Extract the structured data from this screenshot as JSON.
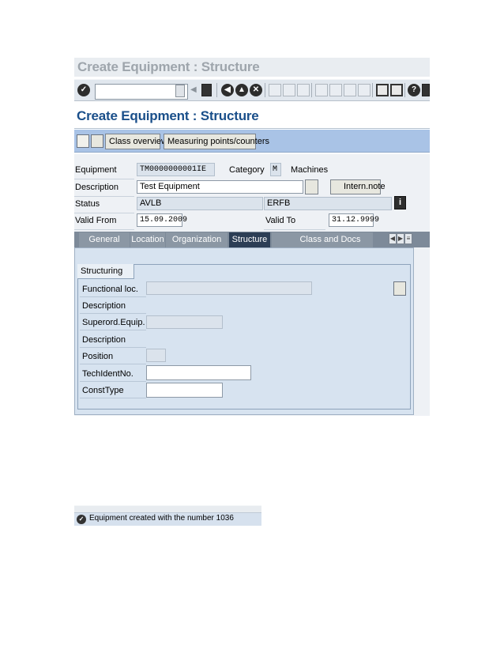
{
  "window": {
    "title": "Create Equipment : Structure"
  },
  "screen": {
    "title": "Create Equipment : Structure"
  },
  "toolbar": {
    "icons": [
      "enter-icon",
      "command-field",
      "back-icon",
      "save-icon",
      "back-nav-icon",
      "exit-icon",
      "cancel-icon",
      "print-icon",
      "find-icon",
      "find-next-icon",
      "first-page-icon",
      "previous-page-icon",
      "next-page-icon",
      "last-page-icon",
      "create-session-icon",
      "shortcut-icon",
      "help-icon",
      "layout-menu-icon"
    ]
  },
  "app_toolbar": {
    "class_overview": "Class overview",
    "measuring_points": "Measuring points/counters"
  },
  "header": {
    "equipment_label": "Equipment",
    "equipment_value": "TM0000000001IE",
    "category_label": "Category",
    "category_value": "M",
    "category_text": "Machines",
    "description_label": "Description",
    "description_value": "Test Equipment",
    "intern_note": "Intern.note",
    "status_label": "Status",
    "status_value": "AVLB",
    "status_value2": "ERFB",
    "valid_from_label": "Valid From",
    "valid_from_value": "15.09.2009",
    "valid_to_label": "Valid To",
    "valid_to_value": "31.12.9999"
  },
  "tabs": [
    {
      "label": "General"
    },
    {
      "label": "Location"
    },
    {
      "label": "Organization"
    },
    {
      "label": "Structure"
    },
    {
      "label": "Class and Docs"
    }
  ],
  "structure": {
    "group_title": "Structuring",
    "functional_loc_label": "Functional loc.",
    "functional_loc_value": "",
    "description1_label": "Description",
    "superord_label": "Superord.Equip.",
    "superord_value": "",
    "description2_label": "Description",
    "position_label": "Position",
    "position_value": "",
    "techident_label": "TechIdentNo.",
    "techident_value": "",
    "consttype_label": "ConstType",
    "consttype_value": ""
  },
  "statusbar": {
    "message": "Equipment created with the number 1036"
  },
  "colors": {
    "screen_title": "#1a4f8a",
    "app_toolbar": "#a9c3e6",
    "tab_active": "#2c3e55"
  }
}
